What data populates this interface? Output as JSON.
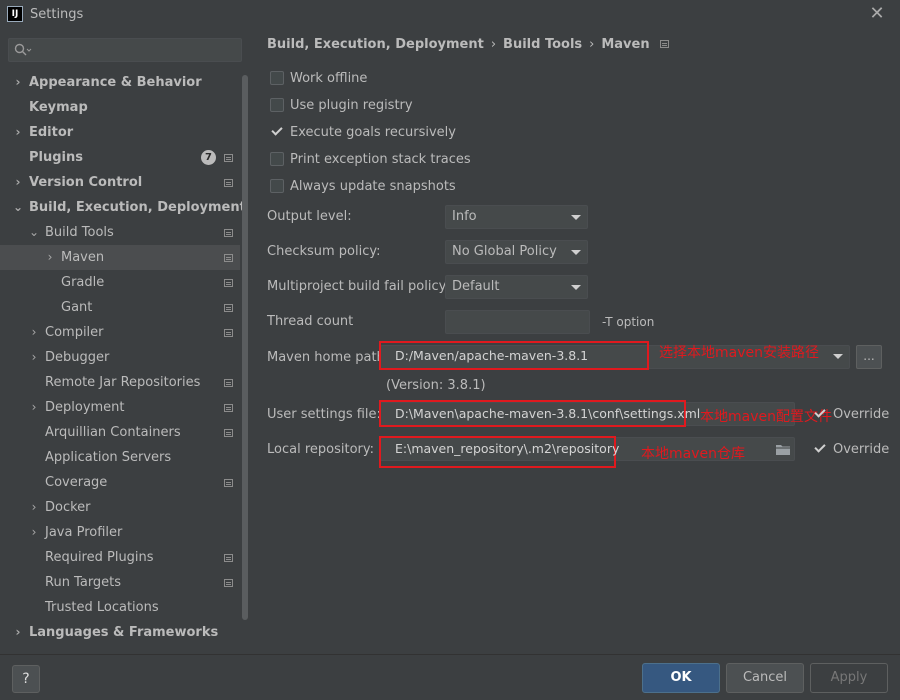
{
  "window": {
    "title": "Settings",
    "logo_text": "IJ",
    "close_glyph": "✕"
  },
  "sidebar": {
    "search": {
      "placeholder": ""
    },
    "items": [
      {
        "label": "Appearance & Behavior"
      },
      {
        "label": "Keymap"
      },
      {
        "label": "Editor"
      },
      {
        "label": "Plugins",
        "badge": "7"
      },
      {
        "label": "Version Control"
      },
      {
        "label": "Build, Execution, Deployment"
      },
      {
        "label": "Build Tools"
      },
      {
        "label": "Maven"
      },
      {
        "label": "Gradle"
      },
      {
        "label": "Gant"
      },
      {
        "label": "Compiler"
      },
      {
        "label": "Debugger"
      },
      {
        "label": "Remote Jar Repositories"
      },
      {
        "label": "Deployment"
      },
      {
        "label": "Arquillian Containers"
      },
      {
        "label": "Application Servers"
      },
      {
        "label": "Coverage"
      },
      {
        "label": "Docker"
      },
      {
        "label": "Java Profiler"
      },
      {
        "label": "Required Plugins"
      },
      {
        "label": "Run Targets"
      },
      {
        "label": "Trusted Locations"
      },
      {
        "label": "Languages & Frameworks"
      }
    ]
  },
  "breadcrumb": {
    "part1": "Build, Execution, Deployment",
    "part2": "Build Tools",
    "part3": "Maven",
    "sep": "›"
  },
  "options": {
    "work_offline": "Work offline",
    "use_plugin_registry": "Use plugin registry",
    "execute_goals_recursively": "Execute goals recursively",
    "print_exception_stack_traces": "Print exception stack traces",
    "always_update_snapshots": "Always update snapshots"
  },
  "form": {
    "output_level": {
      "label": "Output level:",
      "value": "Info"
    },
    "checksum_policy": {
      "label": "Checksum policy:",
      "value": "No Global Policy"
    },
    "multiproject_fail_policy": {
      "label": "Multiproject build fail policy:",
      "value": "Default"
    },
    "thread_count": {
      "label": "Thread count",
      "hint": "-T option"
    },
    "maven_home": {
      "label": "Maven home path:",
      "value": "D:/Maven/apache-maven-3.8.1",
      "version": "(Version: 3.8.1)",
      "browse": "..."
    },
    "user_settings": {
      "label": "User settings file:",
      "value": "D:\\Maven\\apache-maven-3.8.1\\conf\\settings.xml",
      "override": "Override"
    },
    "local_repo": {
      "label": "Local repository:",
      "value": "E:\\maven_repository\\.m2\\repository",
      "override": "Override"
    }
  },
  "annotations": {
    "maven_home": "选择本地maven安装路径",
    "user_settings": "本地maven配置文件",
    "local_repo": "本地maven仓库"
  },
  "footer": {
    "help": "?",
    "ok": "OK",
    "cancel": "Cancel",
    "apply": "Apply"
  },
  "colors": {
    "background": "#3c3f41",
    "accent": "#365880",
    "annotation_red": "#e0191e"
  }
}
